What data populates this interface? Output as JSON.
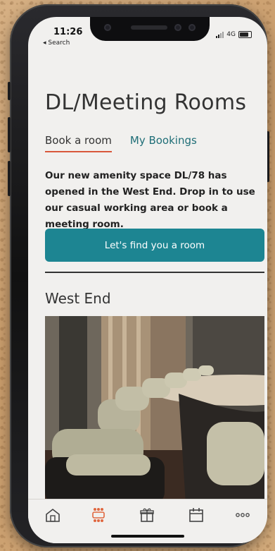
{
  "status_bar": {
    "time": "11:26",
    "back_label": "◂ Search",
    "network": "4G"
  },
  "header": {
    "title": "DL/Meeting Rooms"
  },
  "tabs": [
    {
      "label": "Book a room",
      "active": true
    },
    {
      "label": "My Bookings",
      "active": false
    }
  ],
  "intro_text": "Our new amenity space DL/78 has opened in the West End. Drop in to use our casual working area or book a meeting room.",
  "cta_label": "Let's find you a room",
  "section_title": "West End",
  "bottom_nav": [
    {
      "icon": "home-icon",
      "active": false
    },
    {
      "icon": "meeting-room-icon",
      "active": true
    },
    {
      "icon": "gift-icon",
      "active": false
    },
    {
      "icon": "calendar-icon",
      "active": false
    },
    {
      "icon": "more-icon",
      "active": false
    }
  ],
  "colors": {
    "accent": "#1d8592",
    "tab_underline": "#d9573b",
    "active_nav": "#e0673f",
    "text": "#333333"
  }
}
